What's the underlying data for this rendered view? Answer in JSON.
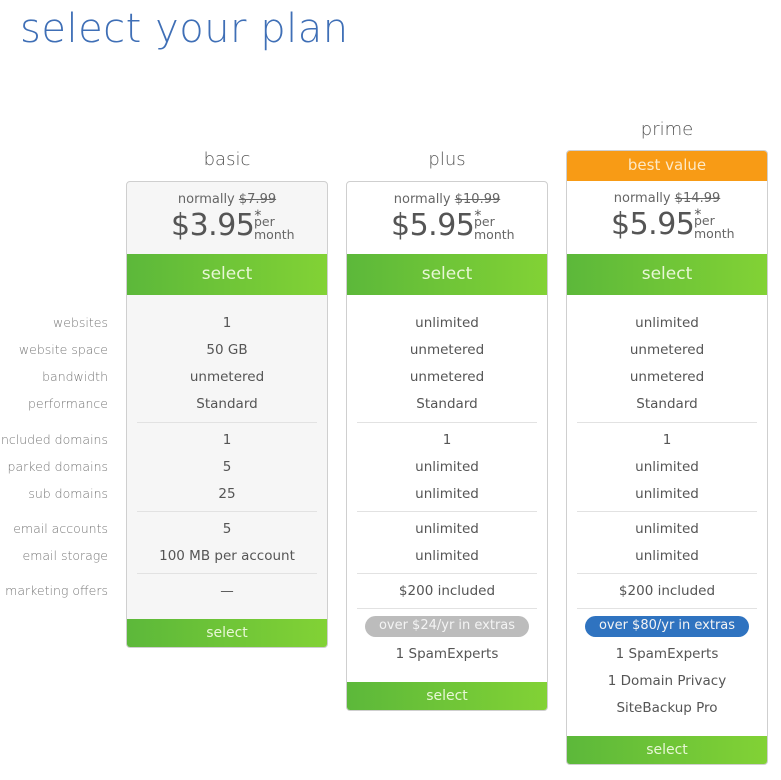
{
  "page": {
    "title": "select your plan"
  },
  "row_labels": [
    "websites",
    "website space",
    "bandwidth",
    "performance",
    "included domains",
    "parked domains",
    "sub domains",
    "email accounts",
    "email storage",
    "marketing offers"
  ],
  "colors": {
    "title": "#3f6fb6",
    "select_button": "#6cc236",
    "best_value": "#f89b15",
    "extras_grey": "#bcbcbc",
    "extras_blue": "#2f73c0"
  },
  "plans": [
    {
      "name": "basic",
      "normally_label": "normally",
      "old_price": "$7.99",
      "price": "$3.95",
      "asterisk": "*",
      "per": "per",
      "month": "month",
      "select_label": "select",
      "features": [
        "1",
        "50 GB",
        "unmetered",
        "Standard",
        "1",
        "5",
        "25",
        "5",
        "100 MB per account",
        "—"
      ],
      "bottom_select_label": "select"
    },
    {
      "name": "plus",
      "normally_label": "normally",
      "old_price": "$10.99",
      "price": "$5.95",
      "asterisk": "*",
      "per": "per",
      "month": "month",
      "select_label": "select",
      "features": [
        "unlimited",
        "unmetered",
        "unmetered",
        "Standard",
        "1",
        "unlimited",
        "unlimited",
        "unlimited",
        "unlimited",
        "$200 included"
      ],
      "extras_badge": "over $24/yr in extras",
      "extras_items": [
        "1 SpamExperts"
      ],
      "bottom_select_label": "select"
    },
    {
      "name": "prime",
      "badge": "best value",
      "normally_label": "normally",
      "old_price": "$14.99",
      "price": "$5.95",
      "asterisk": "*",
      "per": "per",
      "month": "month",
      "select_label": "select",
      "features": [
        "unlimited",
        "unmetered",
        "unmetered",
        "Standard",
        "1",
        "unlimited",
        "unlimited",
        "unlimited",
        "unlimited",
        "$200 included"
      ],
      "extras_badge": "over $80/yr in extras",
      "extras_items": [
        "1 SpamExperts",
        "1 Domain Privacy",
        "SiteBackup Pro"
      ],
      "bottom_select_label": "select"
    }
  ]
}
